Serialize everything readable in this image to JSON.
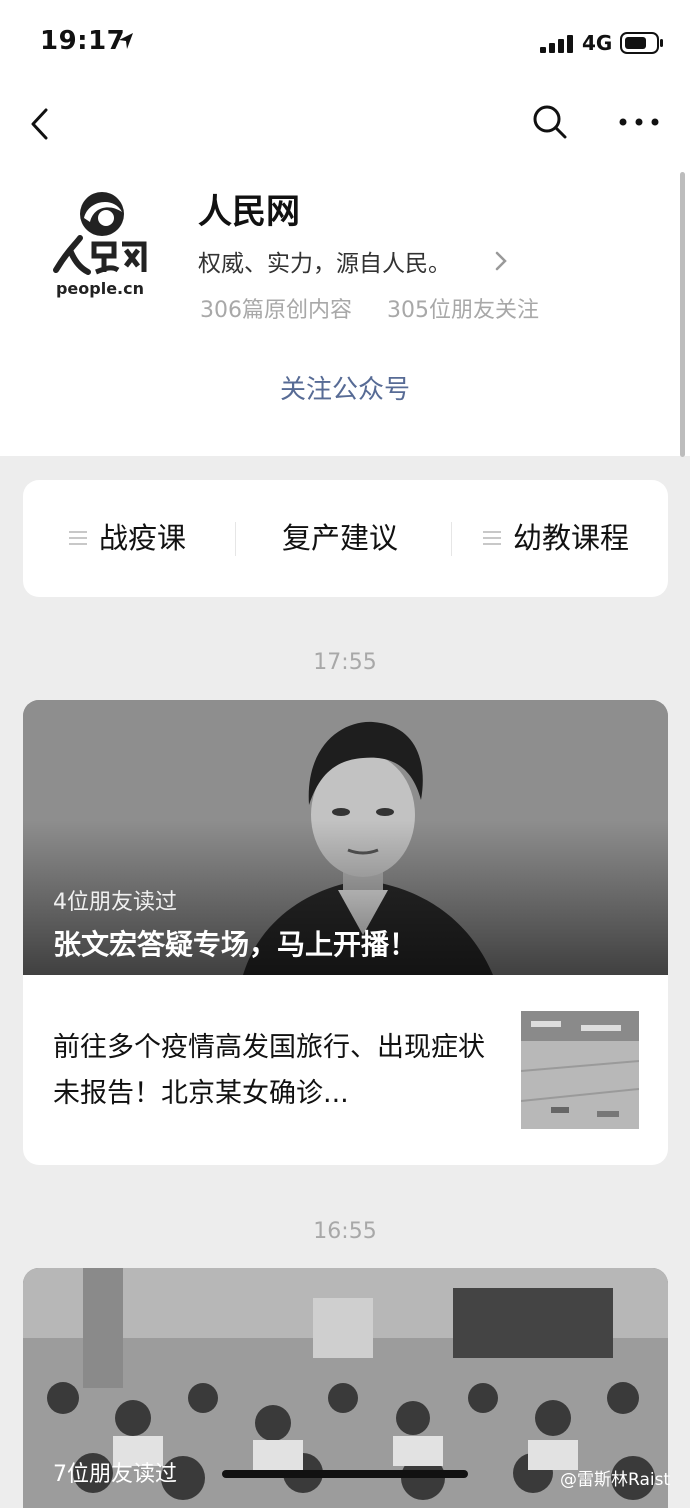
{
  "status_bar": {
    "time": "19:17",
    "network": "4G"
  },
  "account": {
    "name": "人民网",
    "logo_subtext": "people.cn",
    "description": "权威、实力，源自人民。",
    "original_count": "306篇原创内容",
    "friends_following": "305位朋友关注",
    "follow_label": "关注公众号"
  },
  "menu": {
    "items": [
      {
        "label": "战疫课",
        "has_list_icon": true
      },
      {
        "label": "复产建议",
        "has_list_icon": false
      },
      {
        "label": "幼教课程",
        "has_list_icon": true
      }
    ]
  },
  "feed": [
    {
      "timestamp": "17:55",
      "hero": {
        "friends_read": "4位朋友读过",
        "title": "张文宏答疑专场，马上开播！"
      },
      "sub_article": {
        "title": "前往多个疫情高发国旅行、出现症状未报告！北京某女确诊..."
      }
    },
    {
      "timestamp": "16:55",
      "hero": {
        "friends_read": "7位朋友读过"
      }
    }
  ],
  "watermark": "@雷斯林Raist",
  "colors": {
    "link": "#576b95",
    "muted": "#a8a8a8",
    "background": "#ededed"
  }
}
